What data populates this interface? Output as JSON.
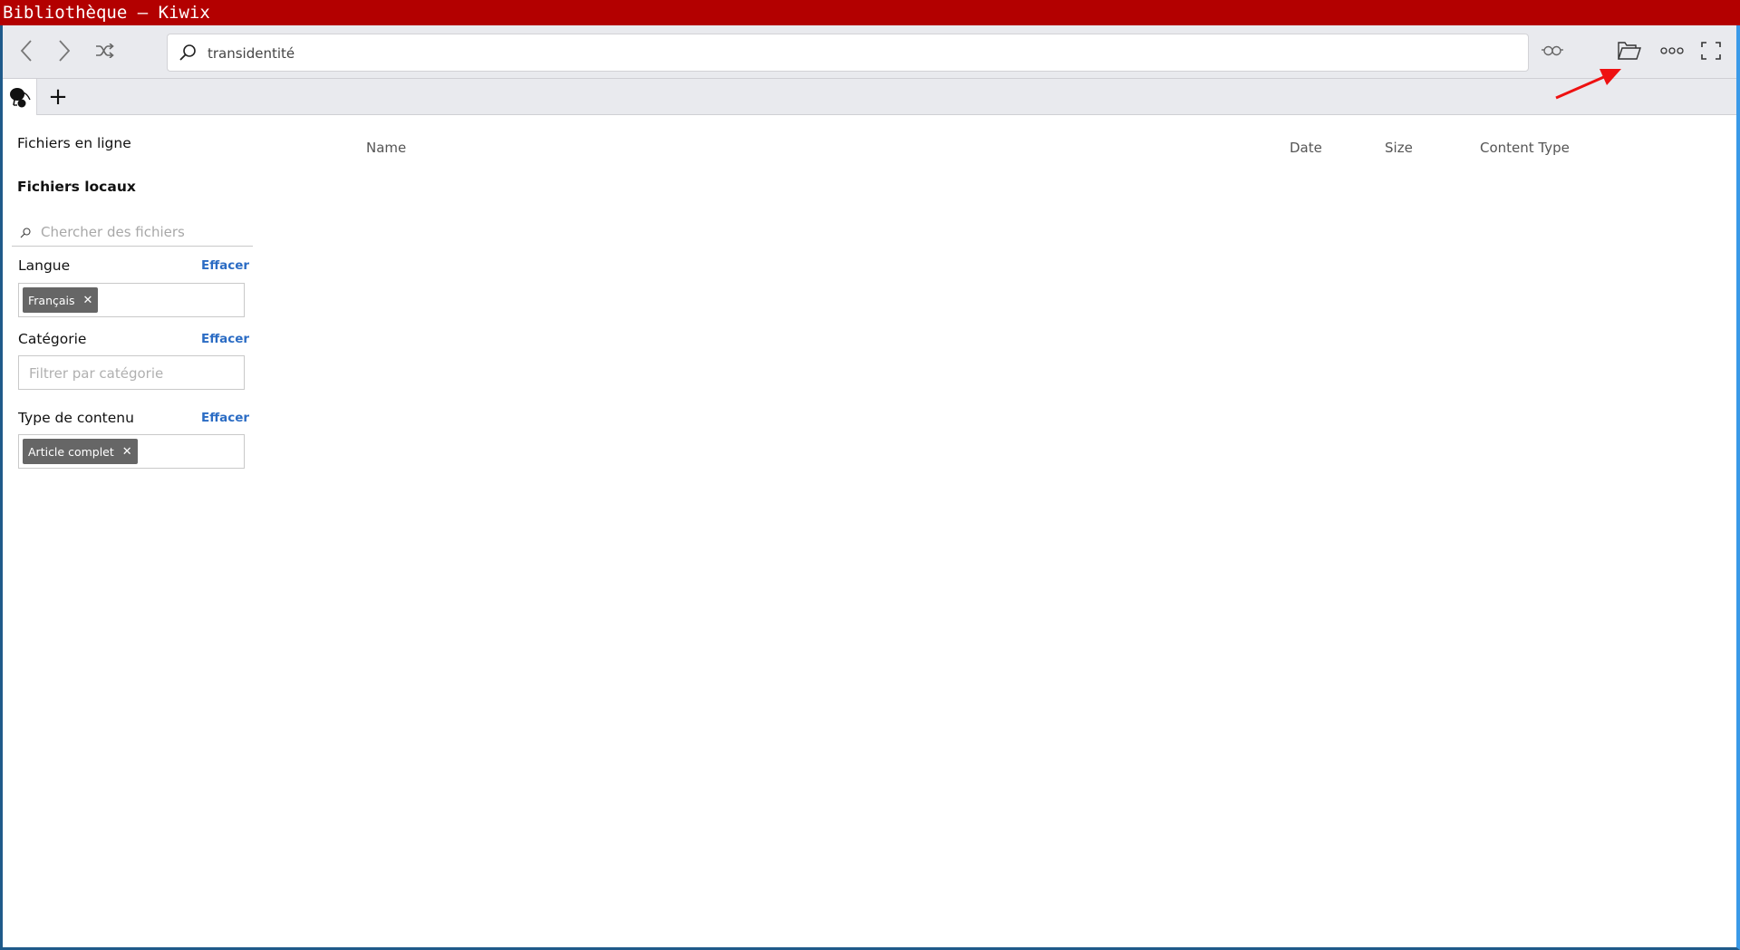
{
  "window": {
    "title": "Bibliothèque — Kiwix"
  },
  "toolbar": {
    "back_icon": "chevron-left-icon",
    "forward_icon": "chevron-right-icon",
    "random_icon": "shuffle-icon",
    "search_value": "transidentité",
    "search_icon": "search-icon",
    "reading_icon": "glasses-icon",
    "open_file_icon": "folder-open-icon",
    "menu_icon": "more-horizontal-icon",
    "fullscreen_icon": "fullscreen-icon"
  },
  "tabs": {
    "active_icon": "kiwix-logo-icon",
    "add_label": "+"
  },
  "sidebar": {
    "online_label": "Fichiers en ligne",
    "local_label": "Fichiers locaux",
    "search_placeholder": "Chercher des fichiers",
    "filters": [
      {
        "label": "Langue",
        "clear": "Effacer",
        "chips": [
          "Français"
        ],
        "placeholder": ""
      },
      {
        "label": "Catégorie",
        "clear": "Effacer",
        "chips": [],
        "placeholder": "Filtrer par catégorie"
      },
      {
        "label": "Type de contenu",
        "clear": "Effacer",
        "chips": [
          "Article complet"
        ],
        "placeholder": ""
      }
    ],
    "chip_remove": "✕"
  },
  "table": {
    "columns": [
      "Name",
      "Date",
      "Size",
      "Content Type"
    ],
    "rows": []
  },
  "annotation": {
    "arrow_color": "#ee1111",
    "points_to": "open-file-button"
  },
  "colors": {
    "titlebar": "#b30000",
    "toolbar": "#e9eaee",
    "link": "#2b6cc4",
    "chip": "#666666"
  }
}
